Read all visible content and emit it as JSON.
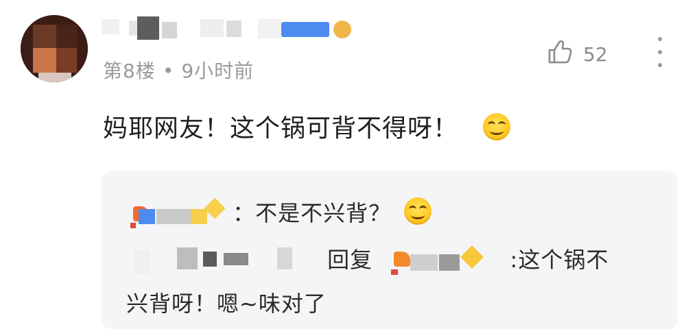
{
  "comment": {
    "floor": "第8楼",
    "separator": "•",
    "time": "9小时前",
    "like_count": "52",
    "text": "妈耶网友！这个锅可背不得呀！"
  },
  "replies": [
    {
      "text": "：不是不兴背？"
    },
    {
      "action": "回复",
      "text_line1": ":这个锅不",
      "text_line2": "兴背呀！嗯~味对了"
    }
  ],
  "icons": {
    "like": "thumbs-up-icon",
    "more": "more-vertical-icon",
    "emoji": "grin-emoji-icon"
  },
  "colors": {
    "meta_gray": "#9a9a9a",
    "reply_bg": "#f5f5f7"
  }
}
